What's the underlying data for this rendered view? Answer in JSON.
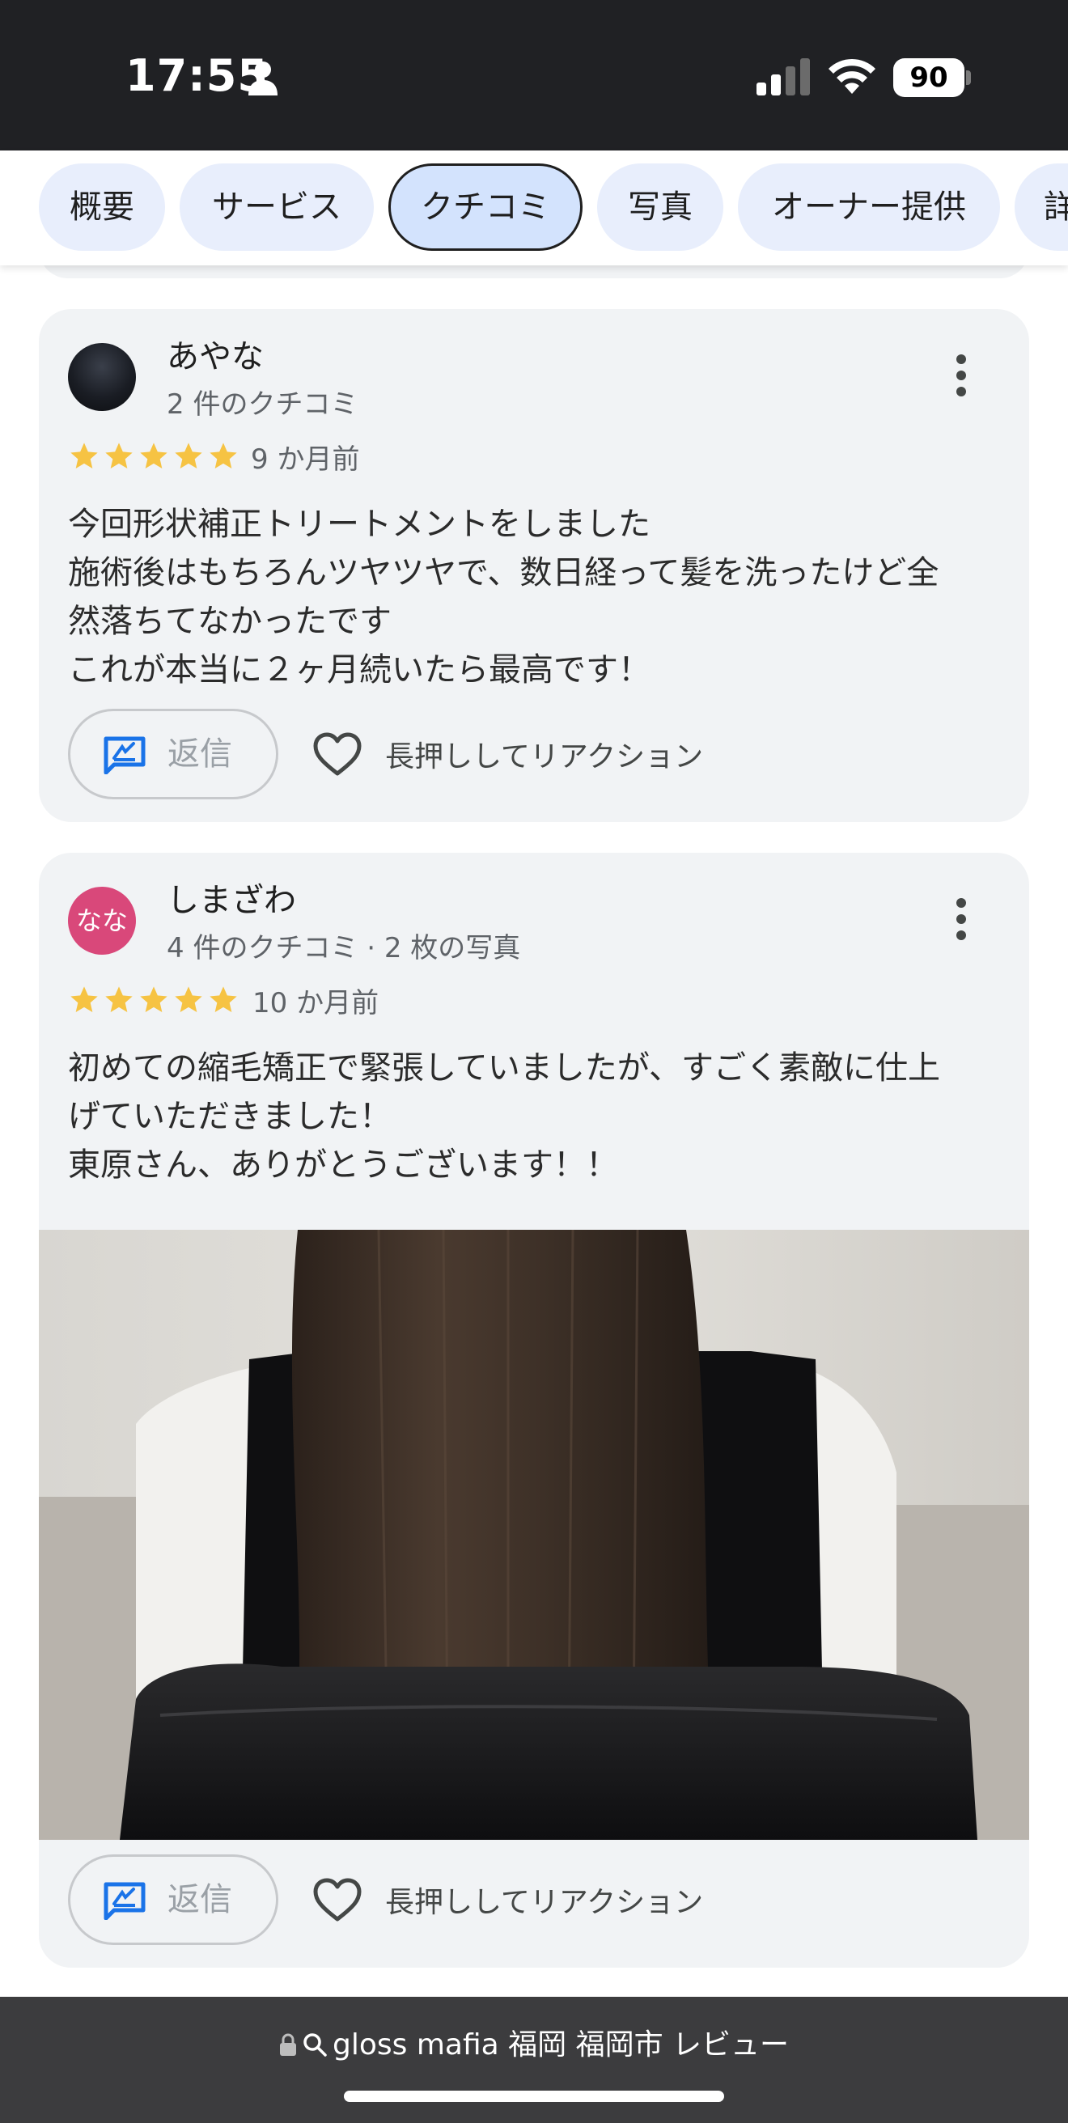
{
  "status_bar": {
    "time": "17:55",
    "battery": "90"
  },
  "tabs": [
    {
      "label": "概要"
    },
    {
      "label": "サービス"
    },
    {
      "label": "クチコミ",
      "active": true
    },
    {
      "label": "写真"
    },
    {
      "label": "オーナー提供"
    },
    {
      "label": "詳"
    }
  ],
  "reviews": [
    {
      "name": "あやな",
      "meta": "2 件のクチコミ",
      "rating": 5,
      "date": "9 か月前",
      "lines": [
        "今回形状補正トリートメントをしました",
        "施術後はもちろんツヤツヤで、数日経って髪を洗ったけど全",
        "然落ちてなかったです",
        "これが本当に２ヶ月続いたら最高です！"
      ],
      "reply_label": "返信",
      "reaction_label": "長押ししてリアクション"
    },
    {
      "name": "しまざわ",
      "avatar_initials": "なな",
      "meta": "4 件のクチコミ · 2 枚の写真",
      "rating": 5,
      "date": "10 か月前",
      "lines": [
        "初めての縮毛矯正で緊張していましたが、すごく素敵に仕上",
        "げていただきました！",
        "東原さん、ありがとうございます！！"
      ],
      "reply_label": "返信",
      "reaction_label": "長押ししてリアクション"
    }
  ],
  "url_bar": {
    "text": "gloss mafia 福岡 福岡市 レビュー"
  },
  "colors": {
    "star": "#f6c343",
    "reply_icon": "#1a73e8",
    "avatar_pink": "#d9487a",
    "chip": "#e8eefc",
    "chip_active": "#d3e3fd"
  }
}
